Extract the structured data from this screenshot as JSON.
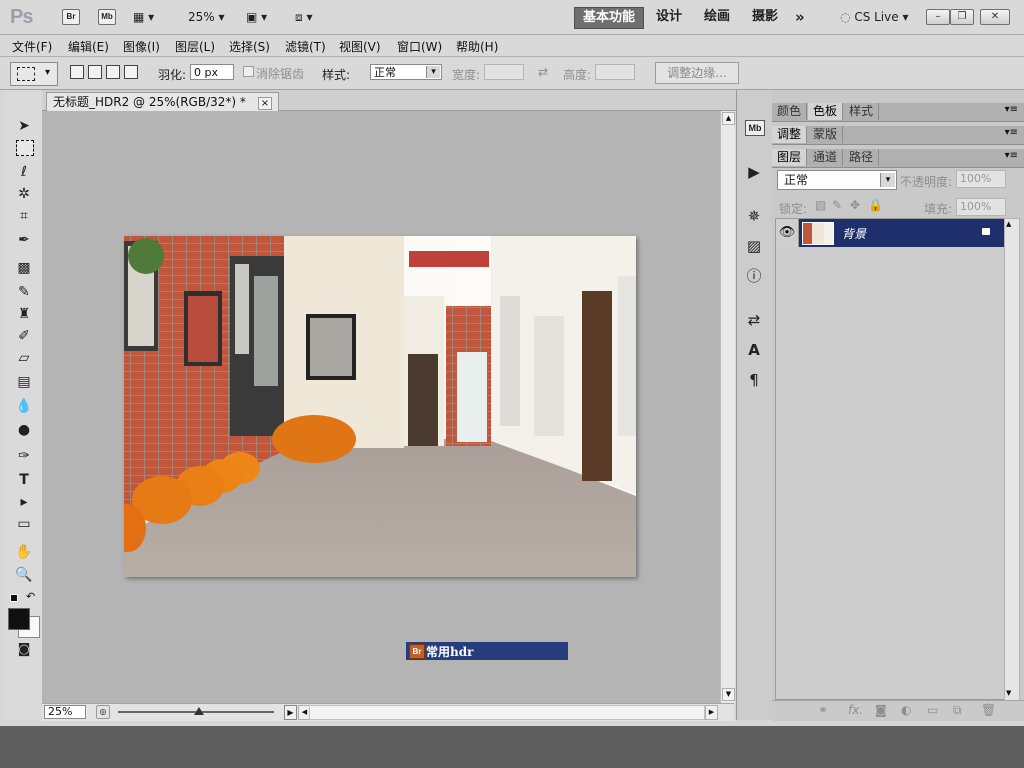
{
  "appbar": {
    "logo": "Ps",
    "bridge": "Br",
    "minibridge": "Mb",
    "zoom": "25%",
    "workspaces": [
      "基本功能",
      "设计",
      "绘画",
      "摄影"
    ],
    "more": "»",
    "cslive": "CS Live"
  },
  "menus": [
    "文件(F)",
    "编辑(E)",
    "图像(I)",
    "图层(L)",
    "选择(S)",
    "滤镜(T)",
    "视图(V)",
    "窗口(W)",
    "帮助(H)"
  ],
  "options": {
    "feather_label": "羽化:",
    "feather_value": "0 px",
    "antialias_label": "消除锯齿",
    "style_label": "样式:",
    "style_value": "正常",
    "width_label": "宽度:",
    "height_label": "高度:",
    "refine_button": "调整边缘..."
  },
  "document": {
    "tab_title": "无标题_HDR2 @ 25%(RGB/32*) *",
    "close": "×",
    "zoom": "25%",
    "bridge_label_icon": "Br",
    "bridge_label": "常用hdr",
    "zoom_slider": 0.52
  },
  "panels": {
    "tabs1": [
      "颜色",
      "色板",
      "样式"
    ],
    "tabs2": [
      "调整",
      "蒙版"
    ],
    "tabs3": [
      "图层",
      "通道",
      "路径"
    ],
    "blend_mode": "正常",
    "opacity_label": "不透明度:",
    "opacity_value": "100%",
    "lock_label": "锁定:",
    "fill_label": "填充:",
    "fill_value": "100%",
    "layer_name": "背景"
  },
  "colors": {
    "selected_layer": "#1f2f6c",
    "bridge_bar": "#263c7c",
    "canvas_bg": "#b4b4b4"
  }
}
